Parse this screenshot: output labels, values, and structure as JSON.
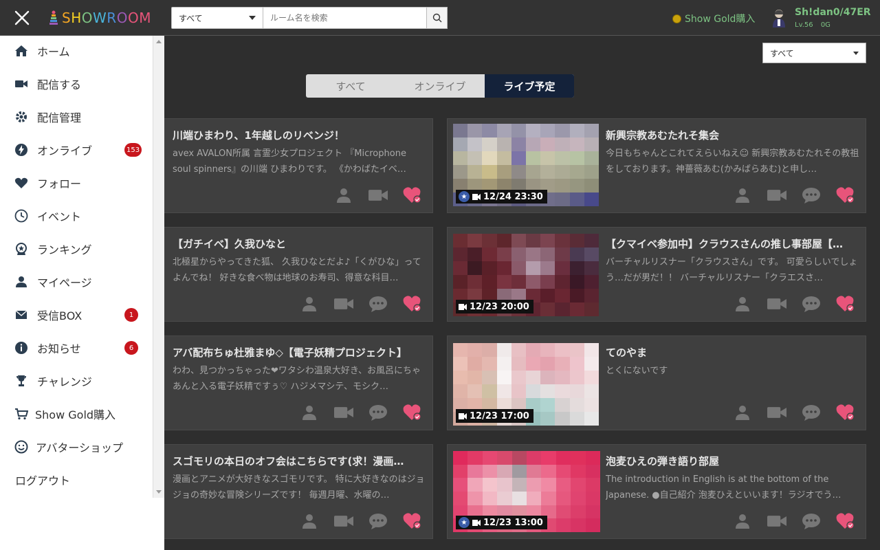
{
  "header": {
    "logo": "SHOWROOM",
    "search_category": "すべて",
    "search_placeholder": "ルーム名を検索",
    "gold_link": "Show Gold購入",
    "user_name": "Sh!dan0/47ER",
    "user_level": "Lv.56",
    "user_gold": "0G"
  },
  "sidebar": {
    "items": [
      {
        "label": "ホーム",
        "icon": "home-icon"
      },
      {
        "label": "配信する",
        "icon": "video-camera-icon"
      },
      {
        "label": "配信管理",
        "icon": "gear-icon"
      },
      {
        "label": "オンライブ",
        "icon": "bolt-icon",
        "badge": "153"
      },
      {
        "label": "フォロー",
        "icon": "heart-icon"
      },
      {
        "label": "イベント",
        "icon": "clock-icon"
      },
      {
        "label": "ランキング",
        "icon": "medal-icon"
      },
      {
        "label": "マイページ",
        "icon": "person-icon"
      },
      {
        "label": "受信BOX",
        "icon": "mail-icon",
        "badge": "1"
      },
      {
        "label": "お知らせ",
        "icon": "info-icon",
        "badge": "6"
      },
      {
        "label": "チャレンジ",
        "icon": "trophy-icon"
      },
      {
        "label": "Show Gold購入",
        "icon": "cart-icon"
      },
      {
        "label": "アバターショップ",
        "icon": "smile-icon"
      }
    ],
    "logout": "ログアウト"
  },
  "filter": {
    "selected": "すべて"
  },
  "tabs": [
    {
      "label": "すべて",
      "active": false
    },
    {
      "label": "オンライブ",
      "active": false
    },
    {
      "label": "ライブ予定",
      "active": true
    }
  ],
  "cards_left": [
    {
      "title": "川端ひまわり、1年越しのリベンジ！",
      "desc": "avex AVALON所属 言霊少女プロジェクト 『Microphone soul spinners』の川端 ひまわりです。 《かわばたイベ…"
    },
    {
      "title": "【ガチイベ】久我ひなと",
      "desc": "北極星からやってきた狐、 久我ひなとだよ♪「くがひな」ってよんでね！ 好きな食べ物は地球のお寿司、得意な科目…"
    },
    {
      "title": "アバ配布ちゅ杜雅まゆ◇【電子妖精プロジェクト】",
      "desc": "わわ、見つかっちゃった❤ワタシわ温泉大好き、お風呂にちゃあんと入る電子妖精ですぅ♡ ハジメマシテ、モシク…"
    },
    {
      "title": "スゴモリの本日のオフ会はこちらです(求！漫画…",
      "desc": "漫画とアニメが大好きなスゴモリです。 特に大好きなのはジョジョの奇妙な冒険シリーズです！ 毎週月曜、水曜の…"
    }
  ],
  "cards_right": [
    {
      "title": "新興宗教あむたれそ集会",
      "desc": "今日もちゃんとこれてえらいねえ☺ 新興宗教あむたれその教祖をしております。神薔薇あむ(かみばらあむ)と申し…",
      "time": "12/24 23:30",
      "star": true
    },
    {
      "title": "【クマイベ参加中】クラウスさんの推し事部屋【…",
      "desc": "バーチャルリスナー「クラウスさん」です。 可愛らしいでしょう…だが男だ！！ バーチャルリスナー「クラエスさ…",
      "time": "12/23 20:00",
      "star": false
    },
    {
      "title": "てのやま",
      "desc": "とくにないです",
      "time": "12/23 17:00",
      "star": false
    },
    {
      "title": "泡麦ひえの弾き語り部屋",
      "desc": "The introduction in English is at the bottom of the Japanese. ●自己紹介 泡麦ひえといいます！ラジオでう…",
      "time": "12/23 13:00",
      "star": true
    }
  ],
  "colors": {
    "accent_green": "#7dc383",
    "tab_active": "#14223a",
    "badge_red": "#c8161d",
    "heart_pink": "#e8547a"
  }
}
